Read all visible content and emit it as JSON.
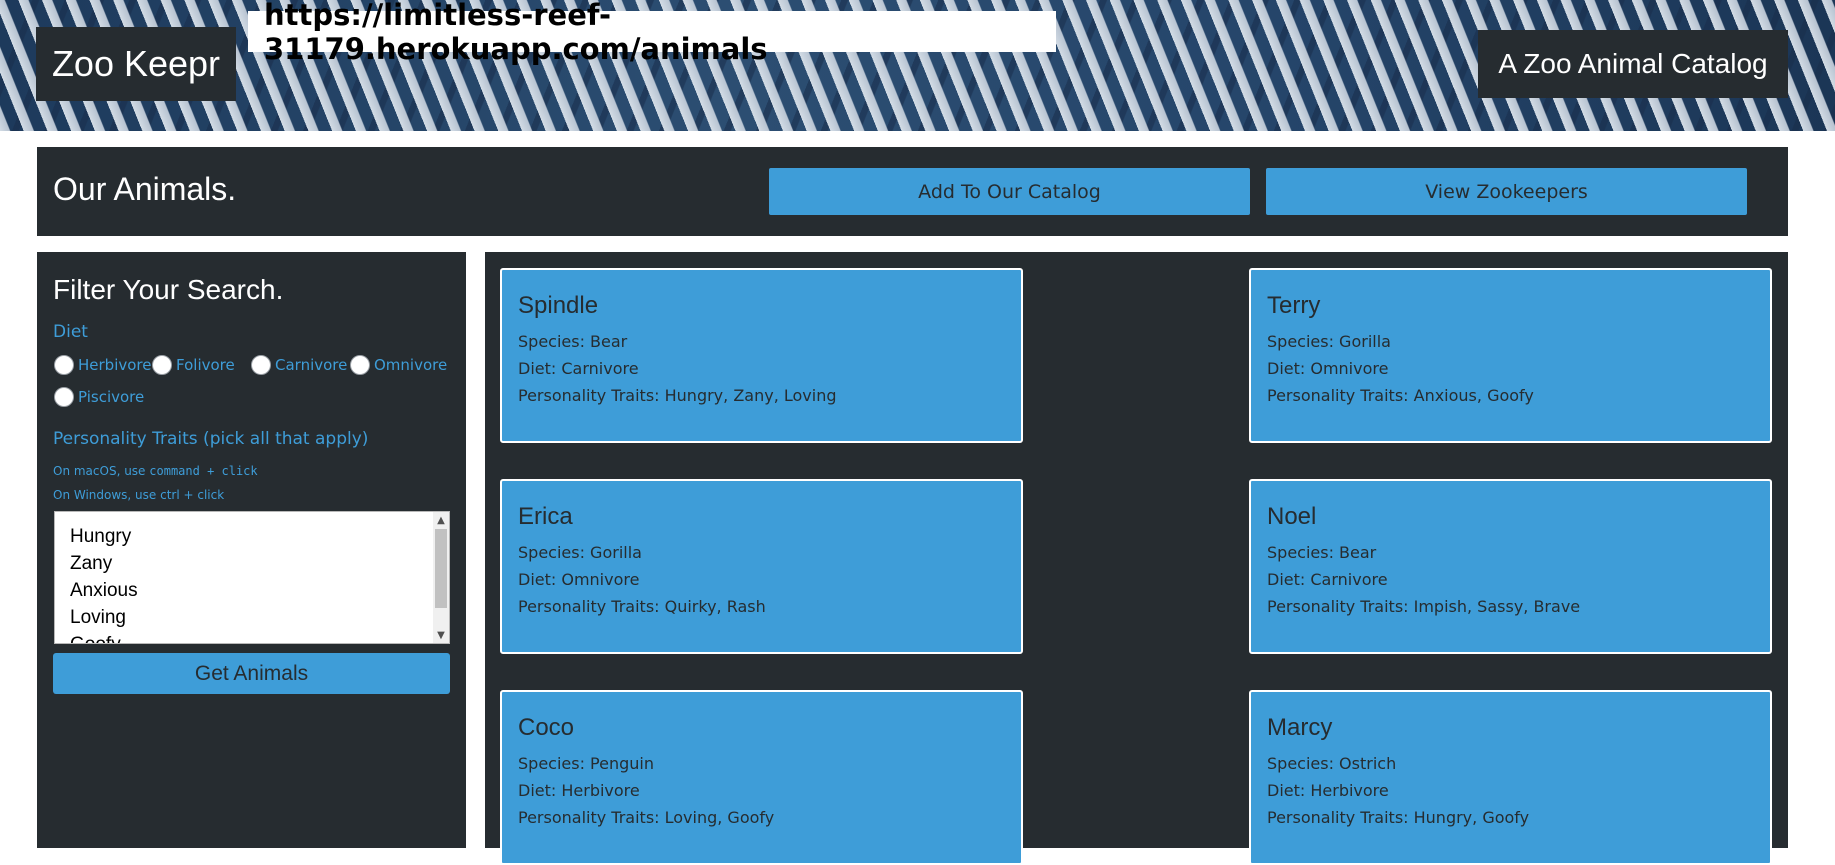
{
  "header": {
    "logo": "Zoo Keepr",
    "url": "https://limitless-reef-31179.herokuapp.com/animals",
    "tagline": "A Zoo Animal Catalog"
  },
  "titlebar": {
    "title": "Our Animals.",
    "add_button": "Add To Our Catalog",
    "zookeepers_button": "View Zookeepers"
  },
  "sidebar": {
    "title": "Filter Your Search.",
    "diet_label": "Diet",
    "diets": [
      "Herbivore",
      "Folivore",
      "Carnivore",
      "Omnivore",
      "Piscivore"
    ],
    "traits_label": "Personality Traits (pick all that apply)",
    "hint_mac_prefix": "On macOS, use ",
    "hint_mac_code": "command + click",
    "hint_windows": "On Windows, use ctrl + click",
    "trait_options": [
      "Hungry",
      "Zany",
      "Anxious",
      "Loving",
      "Goofy"
    ],
    "get_button": "Get Animals"
  },
  "animals": [
    {
      "name": "Spindle",
      "species": "Species: Bear",
      "diet": "Diet: Carnivore",
      "traits": "Personality Traits: Hungry, Zany, Loving"
    },
    {
      "name": "Terry",
      "species": "Species: Gorilla",
      "diet": "Diet: Omnivore",
      "traits": "Personality Traits: Anxious, Goofy"
    },
    {
      "name": "Erica",
      "species": "Species: Gorilla",
      "diet": "Diet: Omnivore",
      "traits": "Personality Traits: Quirky, Rash"
    },
    {
      "name": "Noel",
      "species": "Species: Bear",
      "diet": "Diet: Carnivore",
      "traits": "Personality Traits: Impish, Sassy, Brave"
    },
    {
      "name": "Coco",
      "species": "Species: Penguin",
      "diet": "Diet: Herbivore",
      "traits": "Personality Traits: Loving, Goofy"
    },
    {
      "name": "Marcy",
      "species": "Species: Ostrich",
      "diet": "Diet: Herbivore",
      "traits": "Personality Traits: Hungry, Goofy"
    }
  ],
  "colors": {
    "accent": "#3e9dd8",
    "panel": "#262c30",
    "background": "#ffffff"
  }
}
